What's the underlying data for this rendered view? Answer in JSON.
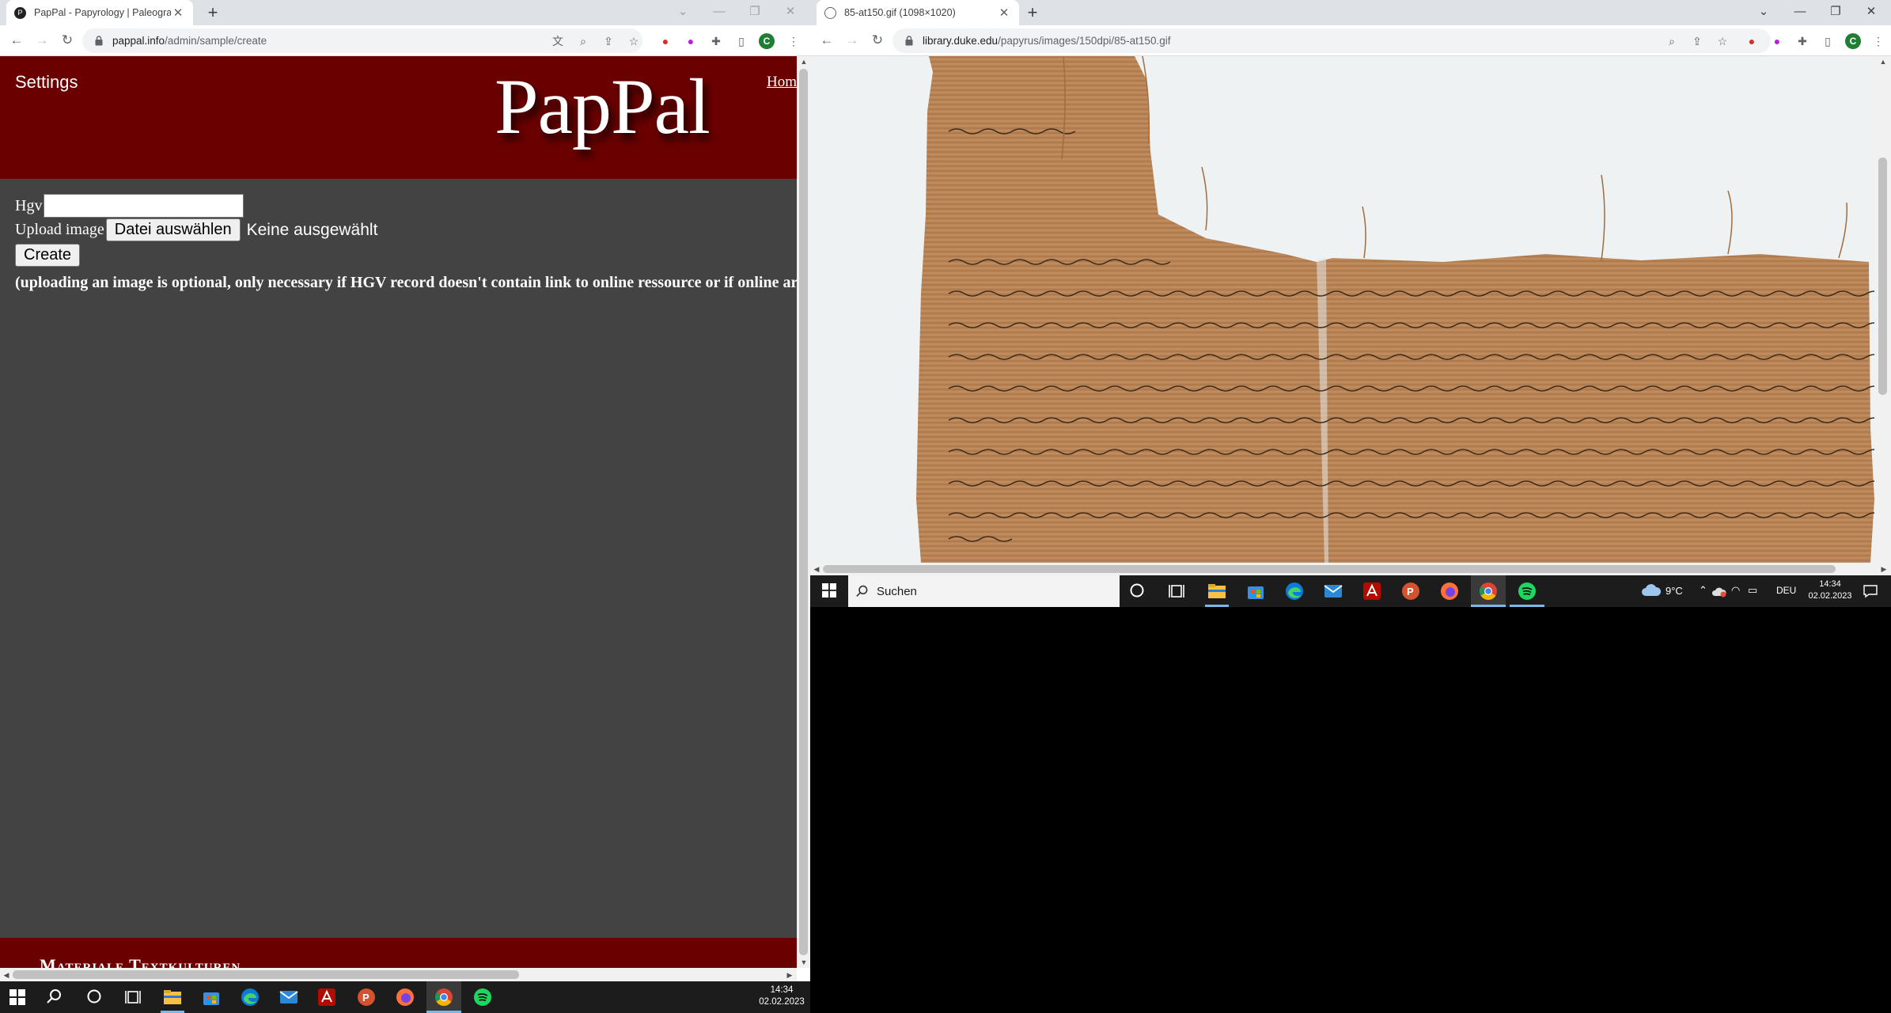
{
  "left_window": {
    "tab": {
      "title": "PapPal - Papyrology | Paleography",
      "close": "✕"
    },
    "new_tab": "+",
    "controls": {
      "chevron": "⌄",
      "minimize": "—",
      "restore": "❐",
      "close": "✕"
    },
    "url": {
      "host": "pappal.info",
      "path": "/admin/sample/create"
    },
    "profile_initial": "C",
    "page": {
      "settings_label": "Settings",
      "logo": "PapPal",
      "home_link": "Home",
      "hgv_label": "Hgv",
      "hgv_value": "",
      "upload_label": "Upload image",
      "file_button": "Datei auswählen",
      "file_status": "Keine ausgewählt",
      "create_button": "Create",
      "note": "(uploading an image is optional, only necessary if HGV record doesn't contain link to online ressource or if online archive",
      "footer_title": "Materiale Textkulturen"
    }
  },
  "right_window": {
    "tab": {
      "title": "85-at150.gif (1098×1020)",
      "close": "✕"
    },
    "new_tab": "+",
    "controls": {
      "chevron": "⌄",
      "minimize": "—",
      "restore": "❐",
      "close": "✕"
    },
    "url": {
      "host": "library.duke.edu",
      "path": "/papyrus/images/150dpi/85-at150.gif"
    },
    "profile_initial": "C"
  },
  "taskbar_bottom": {
    "time": "14:34",
    "date": "02.02.2023"
  },
  "taskbar_right": {
    "search_placeholder": "Suchen",
    "weather": "9°C",
    "language": "DEU",
    "time": "14:34",
    "date": "02.02.2023"
  },
  "colors": {
    "header_red": "#6b0000",
    "page_gray": "#434343",
    "taskbar": "#1c1c1c",
    "papyrus": "#b98456"
  }
}
